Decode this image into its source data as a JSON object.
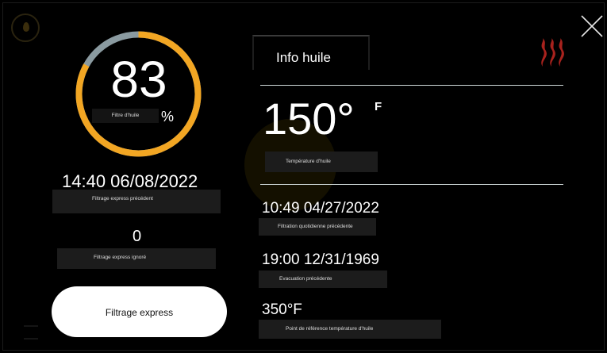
{
  "gauge": {
    "value": "83",
    "fraction": 0.83,
    "label": "Filtre d'huile",
    "unit": "%",
    "accent": "#f2a623",
    "track": "#8a9aa0"
  },
  "left": {
    "last_express": {
      "value": "14:40 06/08/2022",
      "label": "Filtrage express précédent"
    },
    "skipped": {
      "value": "0",
      "label": "Filtrage express ignoré"
    },
    "express_button": "Filtrage express"
  },
  "panel": {
    "title": "Info huile",
    "temperature": {
      "value": "150°",
      "unit": "F",
      "label": "Température d'huile"
    },
    "daily_filter": {
      "value": "10:49 04/27/2022",
      "label": "Filtration quotidienne précédente"
    },
    "evacuation": {
      "value": "19:00 12/31/1969",
      "label": "Evacuation précédente"
    },
    "setpoint": {
      "value": "350°F",
      "label": "Point de référence température d'huile"
    }
  },
  "icons": {
    "close": "close-icon",
    "heat": "heat-icon",
    "heat_color": "#a8221d",
    "drop": "oil-drop-icon"
  }
}
